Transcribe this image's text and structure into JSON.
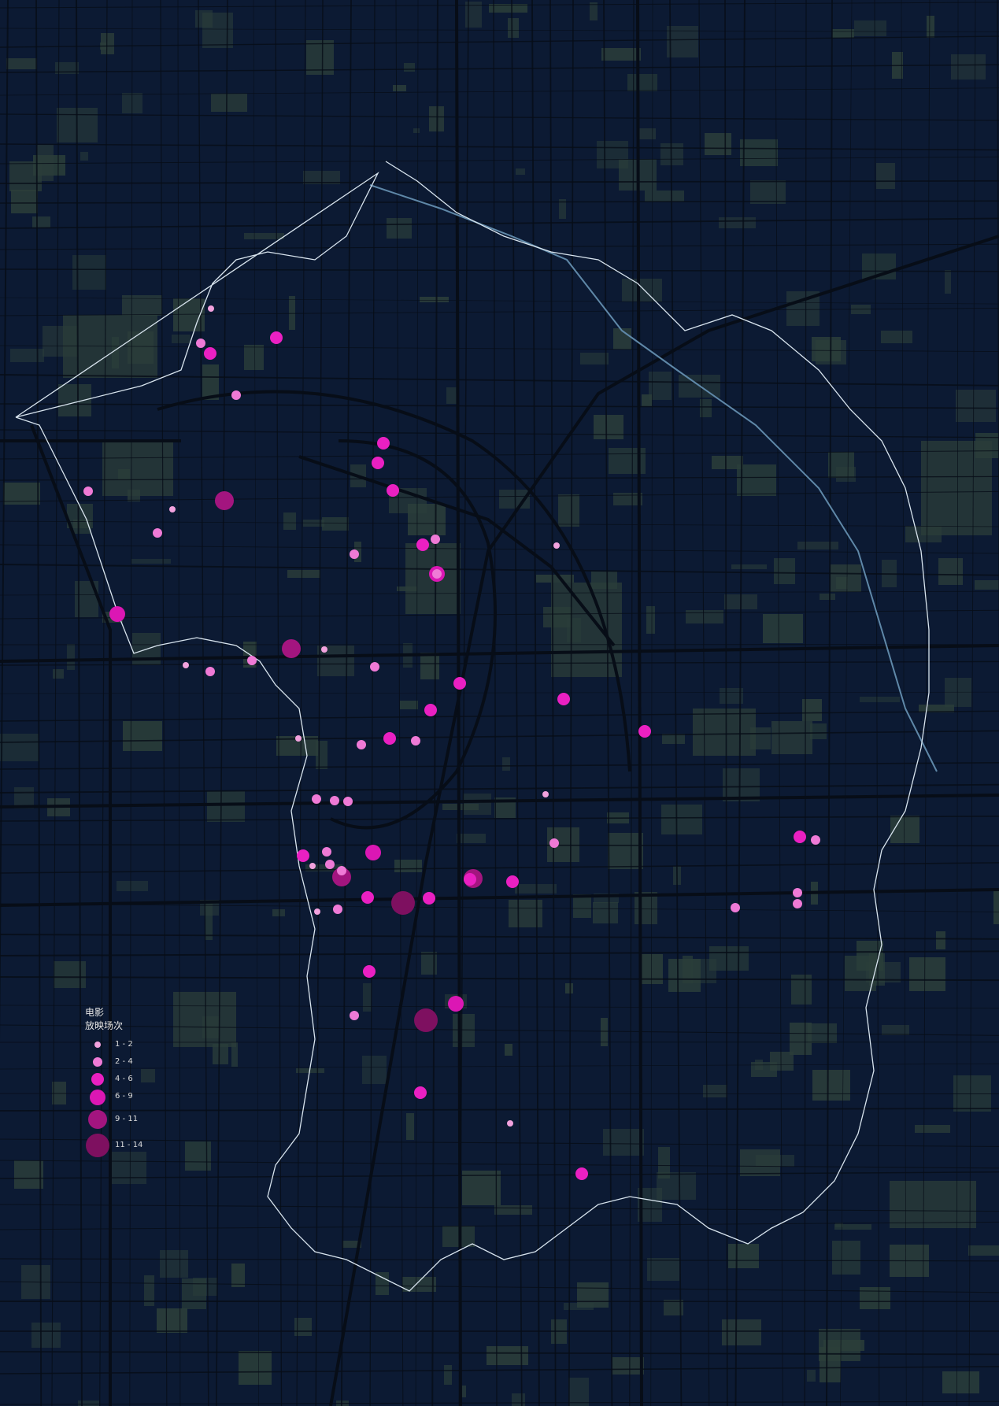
{
  "legend": {
    "title_line1": "电影",
    "title_line2": "放映场次",
    "classes": [
      {
        "label": "1 - 2",
        "color": "#f2a2de"
      },
      {
        "label": "2 - 4",
        "color": "#ef7ad6"
      },
      {
        "label": "4 - 6",
        "color": "#ea20c2"
      },
      {
        "label": "6 - 9",
        "color": "#db17b4"
      },
      {
        "label": "9 - 11",
        "color": "#a3157f"
      },
      {
        "label": "11 - 14",
        "color": "#7e1060"
      }
    ]
  },
  "colors": {
    "background": "#0c1a33",
    "green_patch": "#2b3e3a",
    "road": "#070d17",
    "boundary": "#d8e4ee",
    "river": "#5f88a8"
  }
}
